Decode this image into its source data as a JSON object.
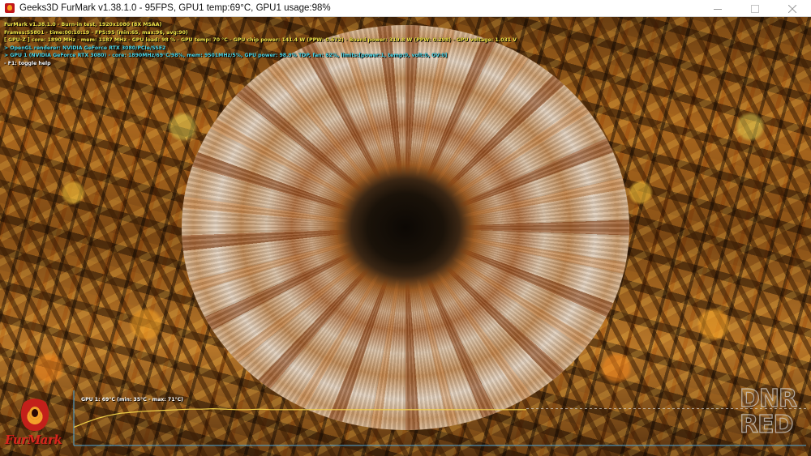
{
  "window": {
    "title": "Geeks3D FurMark v1.38.1.0 - 95FPS, GPU1 temp:69°C, GPU1 usage:98%",
    "icon": "furmark-app-icon"
  },
  "hud": {
    "lines": [
      {
        "text": "FurMark v1.38.1.0 - Burn-in test, 1920x1080 (8X MSAA)",
        "color": "#f7e84a"
      },
      {
        "text": "Frames:55801 - time:00:10:19 - FPS:95 (min:65, max:96, avg:90)",
        "color": "#f7e84a"
      },
      {
        "text": "[ GPU-Z ] core: 1890 MHz - mem: 1187 MHz - GPU load: 98 % - GPU temp: 70 °C - GPU chip power: 141.4 W (PPW: 0.672) - Board power: 319.8 W (PPW: 0.298) - GPU voltage: 1.031 V",
        "color": "#f7e84a"
      },
      {
        "text": "> OpenGL renderer: NVIDIA GeForce RTX 3080/PCIe/SSE2",
        "color": "#4fd8e8"
      },
      {
        "text": "> GPU 1 (NVIDIA GeForce RTX 3080) - core: 1890MHz/69°C/98%, mem: 9501MHz/5%, GPU power: 98.9% TDP, fan: 62%, limits:[power:1, temp:0, volt:0, OV:0]",
        "color": "#4fd8e8"
      },
      {
        "text": "- F1: toggle help",
        "color": "#ffffff"
      }
    ]
  },
  "graph": {
    "label": "GPU 1: 69°C (min: 35°C - max: 71°C)",
    "line_color": "#f2d24a",
    "axis_color": "#4fa8d8"
  },
  "chart_data": {
    "type": "line",
    "series": [
      {
        "name": "GPU 1",
        "values": [
          35,
          44,
          52,
          58,
          62,
          64,
          66,
          67,
          68,
          69,
          70,
          70,
          71,
          70,
          69,
          69,
          70,
          69,
          69,
          69,
          69,
          69,
          69,
          69,
          69,
          69,
          69,
          69,
          69,
          69,
          69,
          69,
          69,
          69,
          69,
          69,
          69,
          69,
          69,
          69
        ]
      }
    ],
    "ylim": [
      0,
      100
    ],
    "grid": false
  },
  "logos": {
    "furmark_word": "FurMark",
    "watermark_lines": [
      "DNR",
      "RED"
    ]
  }
}
